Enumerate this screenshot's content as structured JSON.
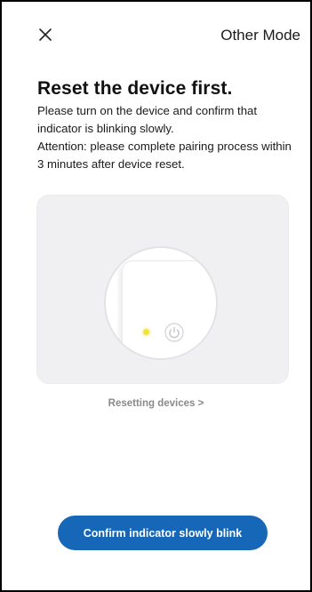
{
  "header": {
    "close_icon": "close-icon",
    "other_mode_label": "Other Mode"
  },
  "content": {
    "title": "Reset the device first.",
    "description_1": "Please turn on the device and confirm that indicator is blinking slowly.",
    "description_2": "Attention: please complete pairing process within 3 minutes after device reset."
  },
  "illustration": {
    "indicator_color": "#f4e23a",
    "power_icon": "power-icon"
  },
  "links": {
    "resetting_devices": "Resetting devices >"
  },
  "actions": {
    "confirm_label": "Confirm indicator slowly blink",
    "confirm_color": "#1767b8"
  }
}
